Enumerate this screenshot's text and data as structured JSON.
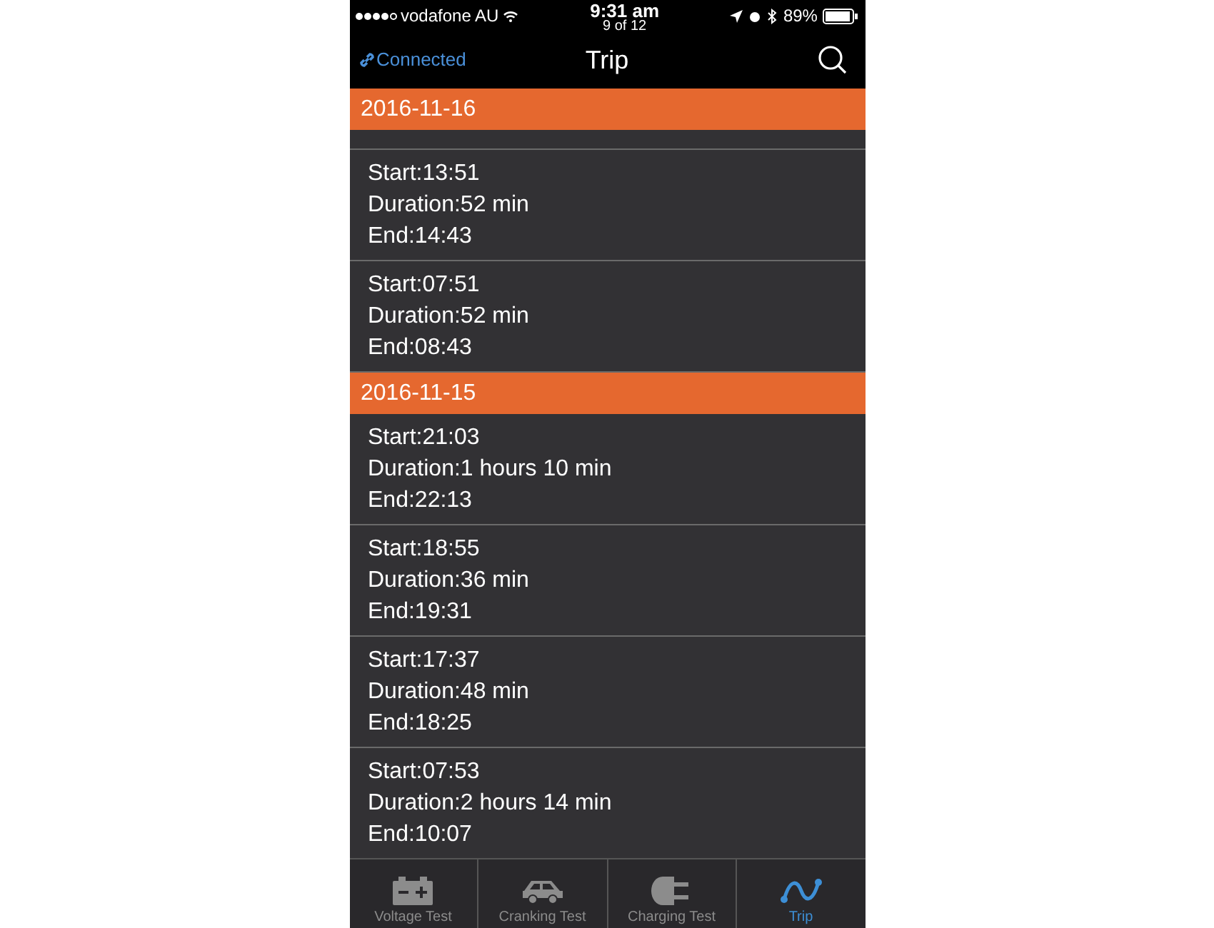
{
  "status_bar": {
    "signal_dots": [
      true,
      true,
      true,
      true,
      false
    ],
    "carrier": "vodafone AU",
    "time": "9:31 am",
    "subtitle": "9 of 12",
    "battery": "89%"
  },
  "nav_bar": {
    "connection": "Connected",
    "title": "Trip"
  },
  "sections": [
    {
      "date": "2016-11-16",
      "partial_row": true,
      "trips": [
        {
          "start": "Start:13:51",
          "duration": "Duration:52 min",
          "end": "End:14:43"
        },
        {
          "start": "Start:07:51",
          "duration": "Duration:52 min",
          "end": "End:08:43"
        }
      ]
    },
    {
      "date": "2016-11-15",
      "partial_row": false,
      "trips": [
        {
          "start": "Start:21:03",
          "duration": "Duration:1 hours 10 min",
          "end": "End:22:13"
        },
        {
          "start": "Start:18:55",
          "duration": "Duration:36 min",
          "end": "End:19:31"
        },
        {
          "start": "Start:17:37",
          "duration": "Duration:48 min",
          "end": "End:18:25"
        },
        {
          "start": "Start:07:53",
          "duration": "Duration:2 hours 14 min",
          "end": "End:10:07"
        }
      ]
    }
  ],
  "tab_bar": [
    {
      "kind": "battery",
      "label": "Voltage Test",
      "selected": false
    },
    {
      "kind": "car",
      "label": "Cranking Test",
      "selected": false
    },
    {
      "kind": "plug",
      "label": "Charging Test",
      "selected": false
    },
    {
      "kind": "trip",
      "label": "Trip",
      "selected": true
    }
  ]
}
